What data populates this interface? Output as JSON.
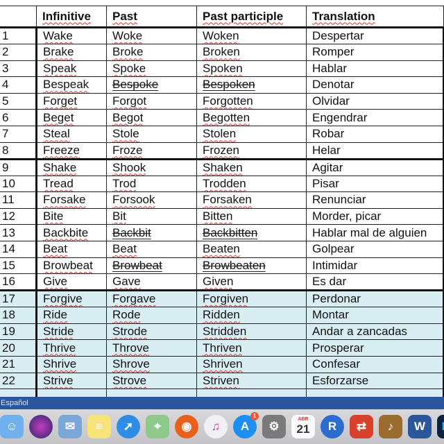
{
  "table": {
    "headers": [
      "",
      "Infinitive",
      "Past",
      "Past participle",
      "Translation"
    ],
    "rows": [
      {
        "n": "1",
        "inf": "Wake",
        "past": "Woke",
        "pp": "Woken",
        "tr": "Despertar",
        "struck": false,
        "group": 1
      },
      {
        "n": "2",
        "inf": "Brake",
        "past": "Broke",
        "pp": "Broken",
        "tr": "Romper",
        "struck": false,
        "group": 1
      },
      {
        "n": "3",
        "inf": "Speak",
        "past": "Spoke",
        "pp": "Spoken",
        "tr": "Hablar",
        "struck": false,
        "group": 1
      },
      {
        "n": "4",
        "inf": "Bespeak",
        "past": "Bespoke",
        "pp": "Bespoken",
        "tr": "Denotar",
        "struck": true,
        "group": 1
      },
      {
        "n": "5",
        "inf": "Forget",
        "past": "Forgot",
        "pp": "Forgotten",
        "tr": "Olvidar",
        "struck": false,
        "group": 1
      },
      {
        "n": "6",
        "inf": "Beget",
        "past": "Begot",
        "pp": "Begotten",
        "tr": "Engendrar",
        "struck": false,
        "group": 1
      },
      {
        "n": "7",
        "inf": "Steal",
        "past": "Stole",
        "pp": "Stolen",
        "tr": "Robar",
        "struck": false,
        "group": 1
      },
      {
        "n": "8",
        "inf": "Freeze",
        "past": "Froze",
        "pp": "Frozen",
        "tr": "Helar",
        "struck": false,
        "group": 1
      },
      {
        "n": "9",
        "inf": "Shake",
        "past": "Shook",
        "pp": "Shaken",
        "tr": "Agitar",
        "struck": false,
        "group": 2
      },
      {
        "n": "10",
        "inf": "Tread",
        "past": "Trod",
        "pp": "Trodden",
        "tr": "Pisar",
        "struck": false,
        "group": 2
      },
      {
        "n": "11",
        "inf": "Forsake",
        "past": "Forsook",
        "pp": "Forsaken",
        "tr": "Renunciar",
        "struck": false,
        "group": 2
      },
      {
        "n": "12",
        "inf": "Bite",
        "past": "Bit",
        "pp": "Bitten",
        "tr": "Morder, picar",
        "struck": false,
        "group": 2
      },
      {
        "n": "13",
        "inf": "Backbite",
        "past": "Backbit",
        "pp": "Backbitten",
        "tr": "Hablar mal de alguien",
        "struck": true,
        "group": 2
      },
      {
        "n": "14",
        "inf": "Beat",
        "past": "Beat",
        "pp": "Beaten",
        "tr": "Golpear",
        "struck": false,
        "group": 2
      },
      {
        "n": "15",
        "inf": "Browbeat",
        "past": "Browbeat",
        "pp": "Browbeaten",
        "tr": "Intimidar",
        "struck": true,
        "group": 2
      },
      {
        "n": "16",
        "inf": "Give",
        "past": "Gave",
        "pp": "Given",
        "tr": "Es dar",
        "struck": false,
        "group": 2
      },
      {
        "n": "17",
        "inf": "Forgive",
        "past": "Forgave",
        "pp": "Forgiven",
        "tr": "Perdonar",
        "struck": false,
        "group": 3
      },
      {
        "n": "18",
        "inf": "Ride",
        "past": "Rode",
        "pp": "Ridden",
        "tr": "Montar",
        "struck": false,
        "group": 3
      },
      {
        "n": "19",
        "inf": "Stride",
        "past": "Strode",
        "pp": "Stridden",
        "tr": "Andar a zancadas",
        "struck": false,
        "group": 3
      },
      {
        "n": "20",
        "inf": "Thrive",
        "past": "Throve",
        "pp": "Thriven",
        "tr": "Prosperar",
        "struck": false,
        "group": 3
      },
      {
        "n": "21",
        "inf": "Shrive",
        "past": "Shrove",
        "pp": "Shriven",
        "tr": "Confesar",
        "struck": false,
        "group": 3
      },
      {
        "n": "22",
        "inf": "Strive",
        "past": "Strove",
        "pp": "Striven",
        "tr": "Esforzarse",
        "struck": false,
        "group": 3
      },
      {
        "n": "",
        "inf": "",
        "past": "",
        "pp": "",
        "tr": "",
        "struck": false,
        "group": 3
      }
    ],
    "highlight_color": "#d9eef3"
  },
  "status_bar": {
    "language": "Español",
    "color": "#2b579a"
  },
  "dock": [
    {
      "name": "finder-icon",
      "glyph": "☺",
      "bg": "#6fb0ee"
    },
    {
      "name": "siri-icon",
      "glyph": "",
      "bg": "radial-gradient(circle,#c33ac0,#2a2a66)",
      "round": true
    },
    {
      "name": "mail-icon",
      "glyph": "✉",
      "bg": "#7aa7d8"
    },
    {
      "name": "notes-icon",
      "glyph": "≡",
      "bg": "#f8e27a"
    },
    {
      "name": "safari-icon",
      "glyph": "➚",
      "bg": "#2e8de6",
      "round": true
    },
    {
      "name": "maps-icon",
      "glyph": "⌖",
      "bg": "#8cc98a"
    },
    {
      "name": "firefox-icon",
      "glyph": "◉",
      "bg": "#e8601c",
      "round": true
    },
    {
      "name": "itunes-icon",
      "glyph": "♫",
      "bg": "#f0f0f5",
      "color": "#e0449a",
      "round": true
    },
    {
      "name": "app-store-icon",
      "glyph": "A",
      "bg": "#1d8ef3",
      "round": true,
      "badge": "1"
    },
    {
      "name": "system-preferences-icon",
      "glyph": "⚙",
      "bg": "#7a7a7a"
    },
    {
      "name": "calendar-icon",
      "glyph": "21",
      "bg": "#fafafa",
      "color": "#333",
      "month": "ABR"
    },
    {
      "name": "r-icon",
      "glyph": "R",
      "bg": "#2b6ccf",
      "round": true
    },
    {
      "name": "remote-desktop-icon",
      "glyph": "⇄",
      "bg": "#d9412c"
    },
    {
      "name": "garageband-icon",
      "glyph": "♪",
      "bg": "#9b6b2f"
    },
    {
      "name": "word-icon",
      "glyph": "W",
      "bg": "#2b579a"
    },
    {
      "name": "photoshop-icon",
      "glyph": "Ps",
      "bg": "#0b2340",
      "color": "#3ba6f2"
    }
  ]
}
